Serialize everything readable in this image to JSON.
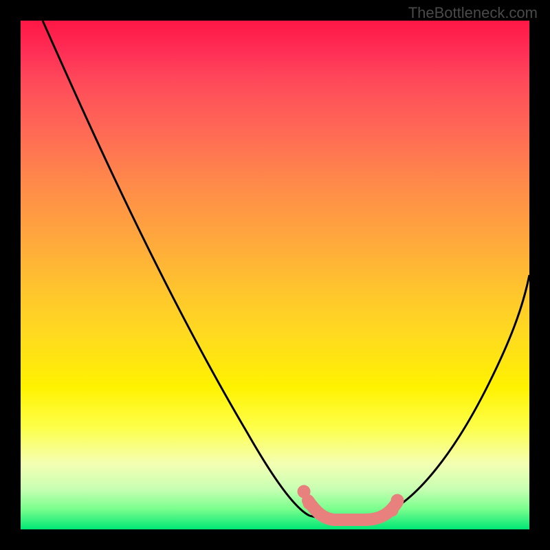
{
  "watermark": "TheBottleneck.com",
  "chart_data": {
    "type": "line",
    "title": "",
    "xlabel": "",
    "ylabel": "",
    "xlim": [
      0,
      100
    ],
    "ylim": [
      0,
      100
    ],
    "series": [
      {
        "name": "bottleneck-curve",
        "x": [
          0,
          10,
          20,
          30,
          40,
          50,
          55,
          58,
          62,
          66,
          70,
          75,
          80,
          85,
          90,
          95,
          100
        ],
        "y": [
          100,
          83,
          67,
          50,
          33,
          17,
          5,
          1,
          0,
          0,
          0,
          2,
          8,
          17,
          27,
          38,
          50
        ]
      }
    ],
    "annotations": [
      {
        "name": "optimum-highlight",
        "type": "marker-band",
        "x_start": 56,
        "x_end": 73,
        "color": "#e8817d"
      }
    ],
    "gradient_stops": [
      {
        "pos": 0,
        "color": "#ff1744"
      },
      {
        "pos": 50,
        "color": "#ffd600"
      },
      {
        "pos": 90,
        "color": "#eeff41"
      },
      {
        "pos": 100,
        "color": "#00e676"
      }
    ]
  }
}
